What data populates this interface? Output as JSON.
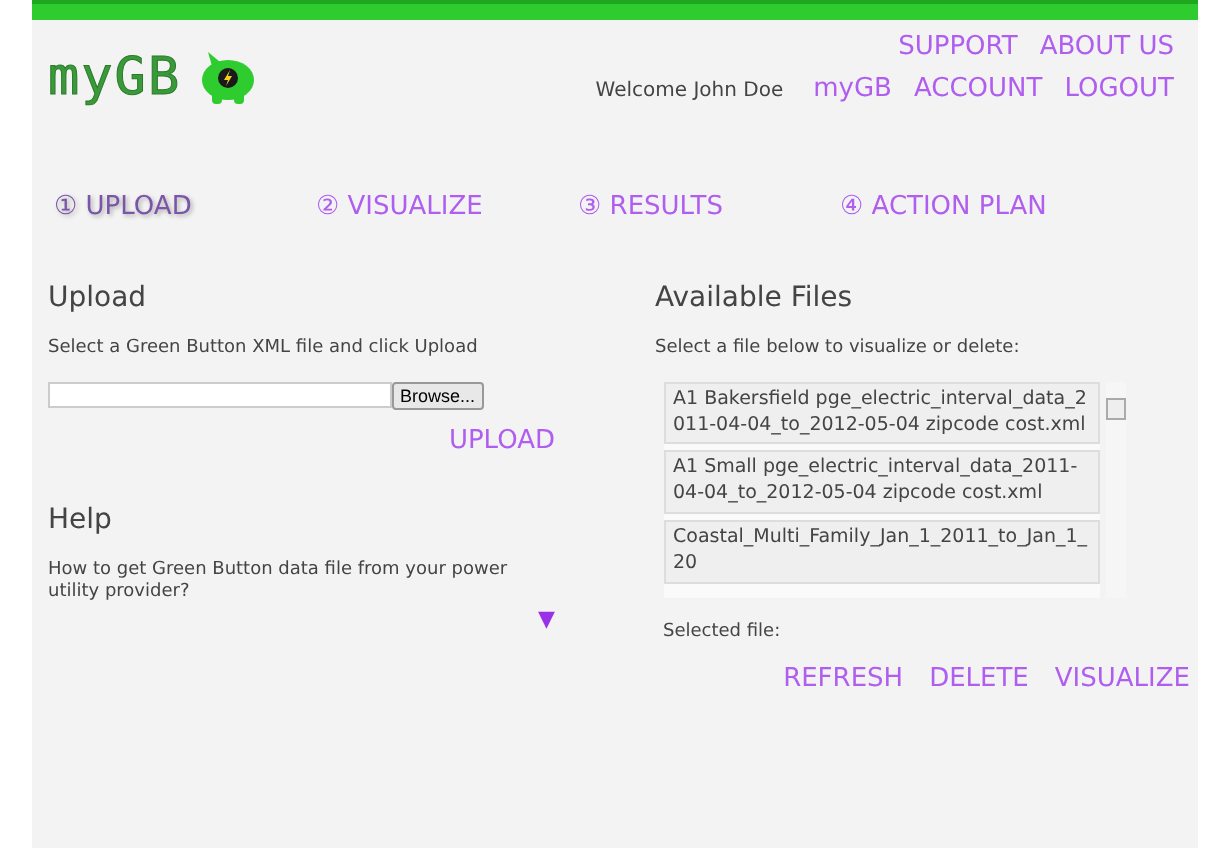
{
  "logo": {
    "text": "myGB"
  },
  "top_links": [
    "SUPPORT",
    "ABOUT US"
  ],
  "welcome": "Welcome John Doe",
  "user_links": [
    "myGB",
    "ACCOUNT",
    "LOGOUT"
  ],
  "steps": [
    {
      "label": "① UPLOAD",
      "selected": true
    },
    {
      "label": "② VISUALIZE",
      "selected": false
    },
    {
      "label": "③ RESULTS",
      "selected": false
    },
    {
      "label": "④ ACTION PLAN",
      "selected": false
    }
  ],
  "upload": {
    "title": "Upload",
    "instruction": "Select a Green Button XML file and click Upload",
    "browse": "Browse...",
    "button": "UPLOAD"
  },
  "help": {
    "title": "Help",
    "question": "How to get Green Button data file from your power utility provider?",
    "expand": "▼"
  },
  "files": {
    "title": "Available Files",
    "instruction": "Select a file below to visualize or delete:",
    "items": [
      {
        "label": "A1 Bakersfield pge_electric_interval_data_2011-04-04_to_2012-05-04 zipcode cost.xml"
      },
      {
        "label": "A1 Small pge_electric_interval_data_2011-04-04_to_2012-05-04 zipcode cost.xml"
      },
      {
        "label": "Coastal_Multi_Family_Jan_1_2011_to_Jan_1_20"
      }
    ],
    "selected_label": "Selected file:",
    "buttons": [
      "REFRESH",
      "DELETE",
      "VISUALIZE"
    ]
  }
}
